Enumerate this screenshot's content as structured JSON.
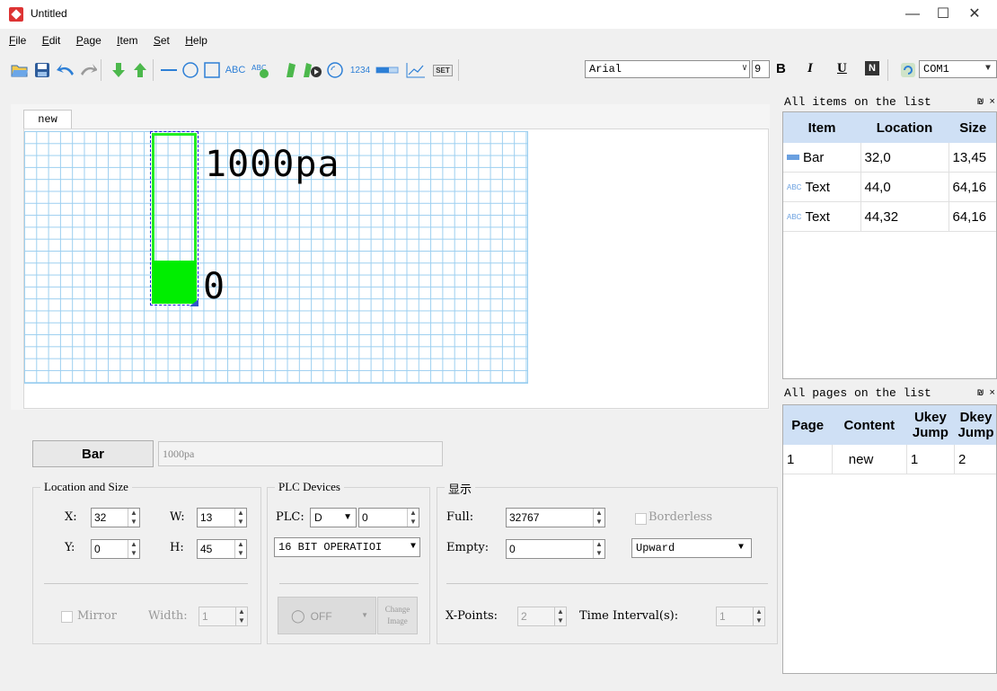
{
  "window": {
    "title": "Untitled",
    "minimize": "—",
    "maximize": "☐",
    "close": "✕"
  },
  "menu": [
    {
      "key": "F",
      "rest": "ile"
    },
    {
      "key": "E",
      "rest": "dit"
    },
    {
      "key": "P",
      "rest": "age"
    },
    {
      "key": "I",
      "rest": "tem"
    },
    {
      "key": "S",
      "rest": "et"
    },
    {
      "key": "H",
      "rest": "elp"
    }
  ],
  "toolbar": {
    "icons": [
      "open-icon",
      "save-icon",
      "undo-icon",
      "redo-icon",
      "move-down-icon",
      "move-up-icon",
      "line-icon",
      "circle-icon",
      "rectangle-icon",
      "text-icon",
      "dynamic-text-icon",
      "image-icon",
      "animation-icon",
      "gauge-icon",
      "number-icon",
      "bar-icon",
      "trend-icon",
      "set-icon"
    ],
    "text_tool_label": "ABC",
    "number_tool_label": "1234",
    "set_tool_label": "SET",
    "font": "Arial",
    "font_size": "9",
    "bold": "B",
    "italic": "I",
    "underline": "U",
    "n_label": "N",
    "port": "COM1"
  },
  "editor": {
    "page_tab": "new",
    "canvas_text_top": "1000pa",
    "canvas_text_bottom": "0",
    "bar_fill_fraction": 0.25
  },
  "items_panel": {
    "title": "All items on the list",
    "pin": "₪ ×",
    "headers": [
      "Item",
      "Location",
      "Size"
    ],
    "rows": [
      {
        "icon": "bar-icon",
        "item": "Bar",
        "location": "32,0",
        "size": "13,45"
      },
      {
        "icon": "text-icon",
        "item": "Text",
        "location": "44,0",
        "size": "64,16"
      },
      {
        "icon": "text-icon",
        "item": "Text",
        "location": "44,32",
        "size": "64,16"
      }
    ],
    "row_icon_text": "ABC"
  },
  "pages_panel": {
    "title": "All pages on the list",
    "pin": "₪ ×",
    "headers": [
      "Page",
      "Content",
      "Ukey Jump",
      "Dkey Jump"
    ],
    "rows": [
      {
        "page": "1",
        "content": "new",
        "ukey": "1",
        "dkey": "2"
      }
    ]
  },
  "properties": {
    "type_button": "Bar",
    "name": "1000pa",
    "location_group": "Location and Size",
    "x_label": "X:",
    "x": "32",
    "w_label": "W:",
    "w": "13",
    "y_label": "Y:",
    "y": "0",
    "h_label": "H:",
    "h": "45",
    "mirror_label": "Mirror",
    "width_label": "Width:",
    "width": "1",
    "plc_group": "PLC Devices",
    "plc_label": "PLC:",
    "plc_device": "D",
    "plc_address": "0",
    "operation": "16 BIT OPERATIOI",
    "off_label": "OFF",
    "change_image": "Change Image",
    "display_group": "显示",
    "full_label": "Full:",
    "full": "32767",
    "empty_label": "Empty:",
    "empty": "0",
    "borderless_label": "Borderless",
    "direction": "Upward",
    "xpoints_label": "X-Points:",
    "xpoints": "2",
    "interval_label": "Time Interval(s):",
    "interval": "1"
  },
  "colors": {
    "bar_fill": "#00ee00",
    "bar_border": "#22ee22",
    "grid": "#9ccff0",
    "header": "#cfe0f5"
  }
}
